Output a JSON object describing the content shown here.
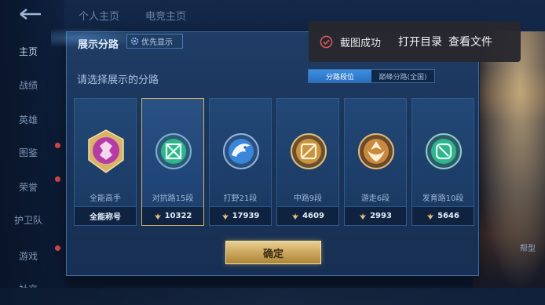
{
  "background": {
    "top_tabs": [
      "个人主页",
      "电竞主页"
    ],
    "sidebar_items": [
      "主页",
      "战绩",
      "英雄",
      "图鉴",
      "荣誉",
      "护卫队",
      "游戏",
      "社交"
    ],
    "right_labels": [
      "帮型"
    ]
  },
  "dialog": {
    "title": "展示分路",
    "priority_button": "优先显示",
    "subtitle": "请选择展示的分路",
    "toggle": {
      "active": "分路段位",
      "inactive": "巅峰分路(全国)"
    },
    "cards": [
      {
        "name": "全能高手",
        "footer": "全能称号",
        "icon": "all-rounder-emblem-icon",
        "color": "#c43fb8"
      },
      {
        "name": "对抗路15段",
        "footer": "10322",
        "icon": "clash-lane-emblem-icon",
        "color": "#2fb58a",
        "selected": true
      },
      {
        "name": "打野21段",
        "footer": "17939",
        "icon": "jungle-emblem-icon",
        "color": "#3a86d8"
      },
      {
        "name": "中路9段",
        "footer": "4609",
        "icon": "mid-lane-emblem-icon",
        "color": "#c99440"
      },
      {
        "name": "游走6段",
        "footer": "2993",
        "icon": "roam-emblem-icon",
        "color": "#c98a40"
      },
      {
        "name": "发育路10段",
        "footer": "5646",
        "icon": "farm-lane-emblem-icon",
        "color": "#2fb58a"
      }
    ],
    "confirm_button": "确定"
  },
  "toast": {
    "message": "截图成功",
    "open_dir": "打开目录",
    "view_file": "查看文件"
  },
  "colors": {
    "accent_blue": "#3c8fe0",
    "gold": "#d8b36a",
    "toast_bg": "#28282e",
    "toast_check": "#e05a5a"
  }
}
